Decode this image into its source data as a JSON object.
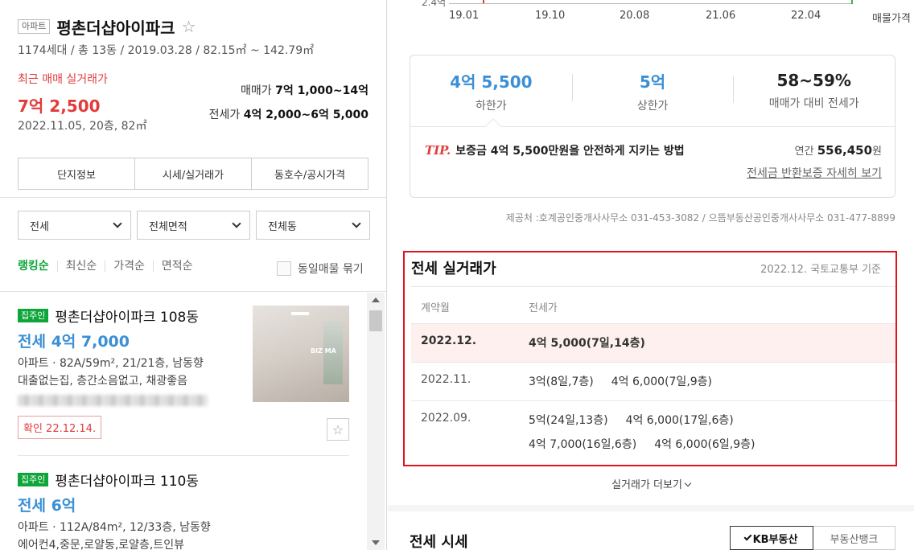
{
  "complex": {
    "type_badge": "아파트",
    "name": "평촌더샵아이파크",
    "summary": "1174세대 / 총 13동 / 2019.03.28 / 82.15㎡ ~ 142.79㎡",
    "recent_label": "최근 매매 실거래가",
    "recent_price": "7억 2,500",
    "recent_date": "2022.11.05, 20층, 82㎡",
    "sale_label": "매매가",
    "sale_range": "7억 1,000~14억",
    "jeonse_label": "전세가",
    "jeonse_range": "4억 2,000~6억 5,000"
  },
  "tabs": [
    "단지정보",
    "시세/실거래가",
    "동호수/공시가격"
  ],
  "filters": [
    "전세",
    "전체면적",
    "전체동"
  ],
  "sort": {
    "options": [
      "랭킹순",
      "최신순",
      "가격순",
      "면적순"
    ],
    "same_listing": "동일매물 묶기"
  },
  "listings": [
    {
      "tag": "집주인",
      "name": "평촌더샵아이파크 108동",
      "price": "전세 4억 7,000",
      "spec": "아파트 · 82A/59m², 21/21층, 남동향",
      "desc": "대출없는집, 층간소음없고, 채광좋음",
      "confirm": "확인 22.12.14.",
      "thumb_watermark": "BIZ MA"
    },
    {
      "tag": "집주인",
      "name": "평촌더샵아이파크 110동",
      "price": "전세 6억",
      "spec": "아파트 · 112A/84m², 12/33층, 남동향",
      "desc": "에어컨4,중문,로얄동,로얄층,트인뷰"
    }
  ],
  "chart_axis": {
    "y_tick": "2.4억",
    "x_ticks": [
      "19.01",
      "19.10",
      "20.08",
      "21.06",
      "22.04"
    ],
    "x_end_label": "매물가격"
  },
  "stats": [
    {
      "value": "4억 5,500",
      "label": "하한가"
    },
    {
      "value": "5억",
      "label": "상한가"
    },
    {
      "value": "58~59%",
      "label": "매매가 대비 전세가"
    }
  ],
  "tip": {
    "label": "TIP.",
    "text": "보증금 4억 5,500만원을 안전하게 지키는 방법",
    "annual_label": "연간",
    "annual_value": "556,450",
    "annual_unit": "원",
    "link": "전세금 반환보증 자세히 보기"
  },
  "provider": "제공처 :호계공인중개사사무소 031-453-3082 / 으뜸부동산공인중개사사무소 031-477-8899",
  "deals": {
    "title": "전세 실거래가",
    "source": "2022.12. 국토교통부 기준",
    "col_date": "계약월",
    "col_price": "전세가",
    "rows": [
      {
        "date": "2022.12.",
        "line1": [
          "4억 5,000(7일,14층)"
        ],
        "line2": []
      },
      {
        "date": "2022.11.",
        "line1": [
          "3억(8일,7층)",
          "4억 6,000(7일,9층)"
        ],
        "line2": []
      },
      {
        "date": "2022.09.",
        "line1": [
          "5억(24일,13층)",
          "4억 6,000(17일,6층)"
        ],
        "line2": [
          "4억 7,000(16일,6층)",
          "4억 6,000(6일,9층)"
        ]
      }
    ],
    "more": "실거래가 더보기"
  },
  "market": {
    "title": "전세 시세",
    "kb": "KB부동산",
    "bank": "부동산뱅크"
  }
}
